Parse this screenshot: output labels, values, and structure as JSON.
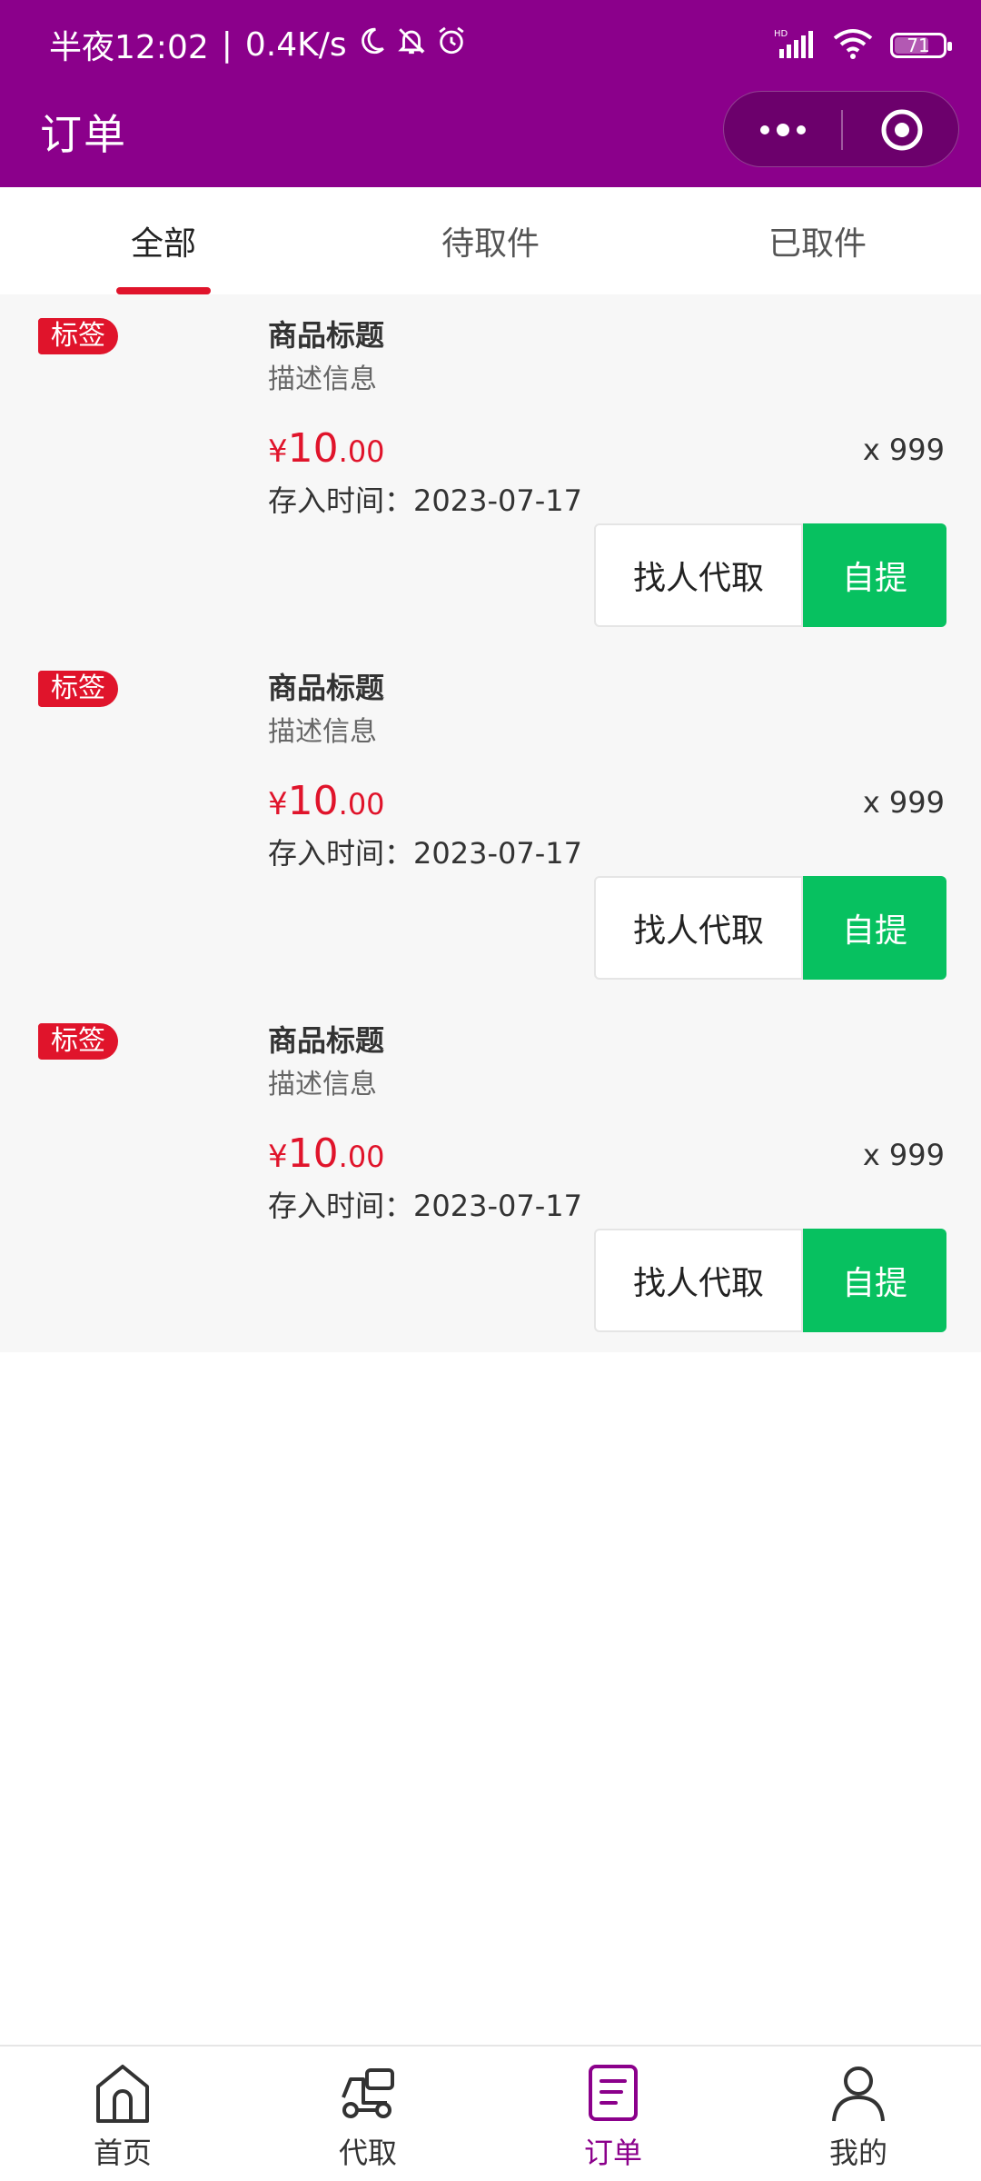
{
  "status_bar": {
    "time": "半夜12:02",
    "separator": "|",
    "speed": "0.4K/s",
    "network_badge": "HD",
    "battery": "71",
    "battery_level": 0.71
  },
  "nav": {
    "title": "订单"
  },
  "tabs": [
    {
      "label": "全部",
      "active": true
    },
    {
      "label": "待取件",
      "active": false
    },
    {
      "label": "已取件",
      "active": false
    }
  ],
  "orders": [
    {
      "tag": "标签",
      "title": "商品标题",
      "desc": "描述信息",
      "currency": "¥",
      "price_int": "10",
      "price_dec": ".00",
      "qty": "x 999",
      "date": "存入时间：2023-07-17",
      "btn_find": "找人代取",
      "btn_self": "自提"
    },
    {
      "tag": "标签",
      "title": "商品标题",
      "desc": "描述信息",
      "currency": "¥",
      "price_int": "10",
      "price_dec": ".00",
      "qty": "x 999",
      "date": "存入时间：2023-07-17",
      "btn_find": "找人代取",
      "btn_self": "自提"
    },
    {
      "tag": "标签",
      "title": "商品标题",
      "desc": "描述信息",
      "currency": "¥",
      "price_int": "10",
      "price_dec": ".00",
      "qty": "x 999",
      "date": "存入时间：2023-07-17",
      "btn_find": "找人代取",
      "btn_self": "自提"
    }
  ],
  "tabbar": [
    {
      "label": "首页",
      "icon": "home-icon"
    },
    {
      "label": "代取",
      "icon": "delivery-cart-icon"
    },
    {
      "label": "订单",
      "icon": "order-list-icon",
      "active": true
    },
    {
      "label": "我的",
      "icon": "user-icon"
    }
  ],
  "colors": {
    "brand": "#8b008b",
    "accent_red": "#e0142b",
    "button_green": "#07c160"
  }
}
